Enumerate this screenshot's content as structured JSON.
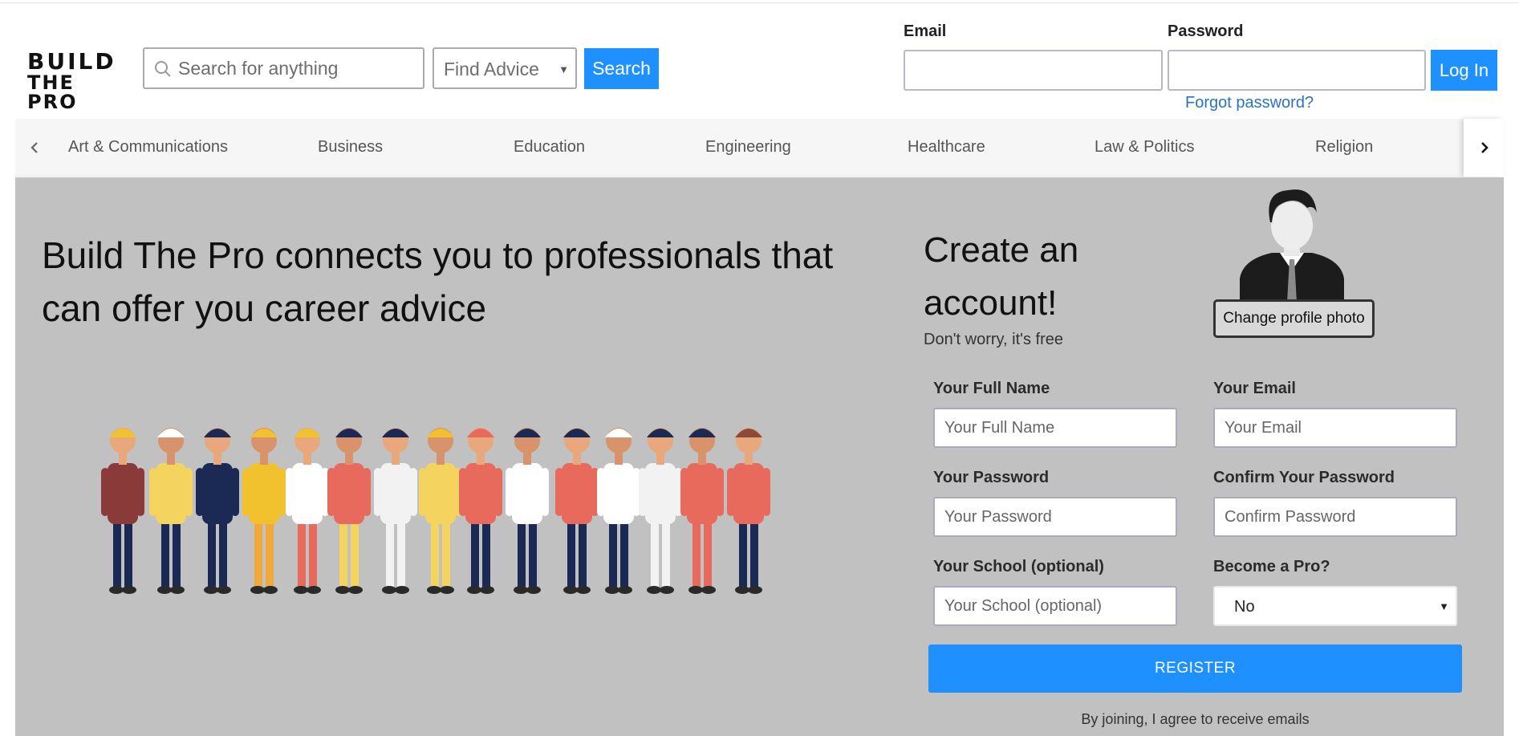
{
  "brand": {
    "line1": "BUILD",
    "line2": "THE PRO"
  },
  "search": {
    "placeholder": "Search for anything",
    "icon": "search-icon"
  },
  "advice_select": {
    "selected": "Find Advice"
  },
  "search_button": "Search",
  "login": {
    "email_label": "Email",
    "password_label": "Password",
    "button": "Log In",
    "forgot": "Forgot password?"
  },
  "categories": [
    "Art & Communications",
    "Business",
    "Education",
    "Engineering",
    "Healthcare",
    "Law & Politics",
    "Religion"
  ],
  "hero": {
    "headline": "Build The Pro connects you to professionals that can offer you career advice"
  },
  "signup": {
    "title": "Create an account!",
    "subtitle": "Don't worry, it's free",
    "change_photo": "Change profile photo",
    "full_name": {
      "label": "Your Full Name",
      "placeholder": "Your Full Name"
    },
    "email": {
      "label": "Your Email",
      "placeholder": "Your Email"
    },
    "password": {
      "label": "Your Password",
      "placeholder": "Your Password"
    },
    "confirm": {
      "label": "Confirm Your Password",
      "placeholder": "Confirm Password"
    },
    "school": {
      "label": "Your School (optional)",
      "placeholder": "Your School (optional)"
    },
    "become_pro": {
      "label": "Become a Pro?",
      "selected": "No"
    },
    "register": "REGISTER",
    "consent": "By joining, I agree to receive emails"
  },
  "colors": {
    "accent": "#1e90ff",
    "hero_bg": "#c1c1c1",
    "link": "#2a73c2"
  }
}
